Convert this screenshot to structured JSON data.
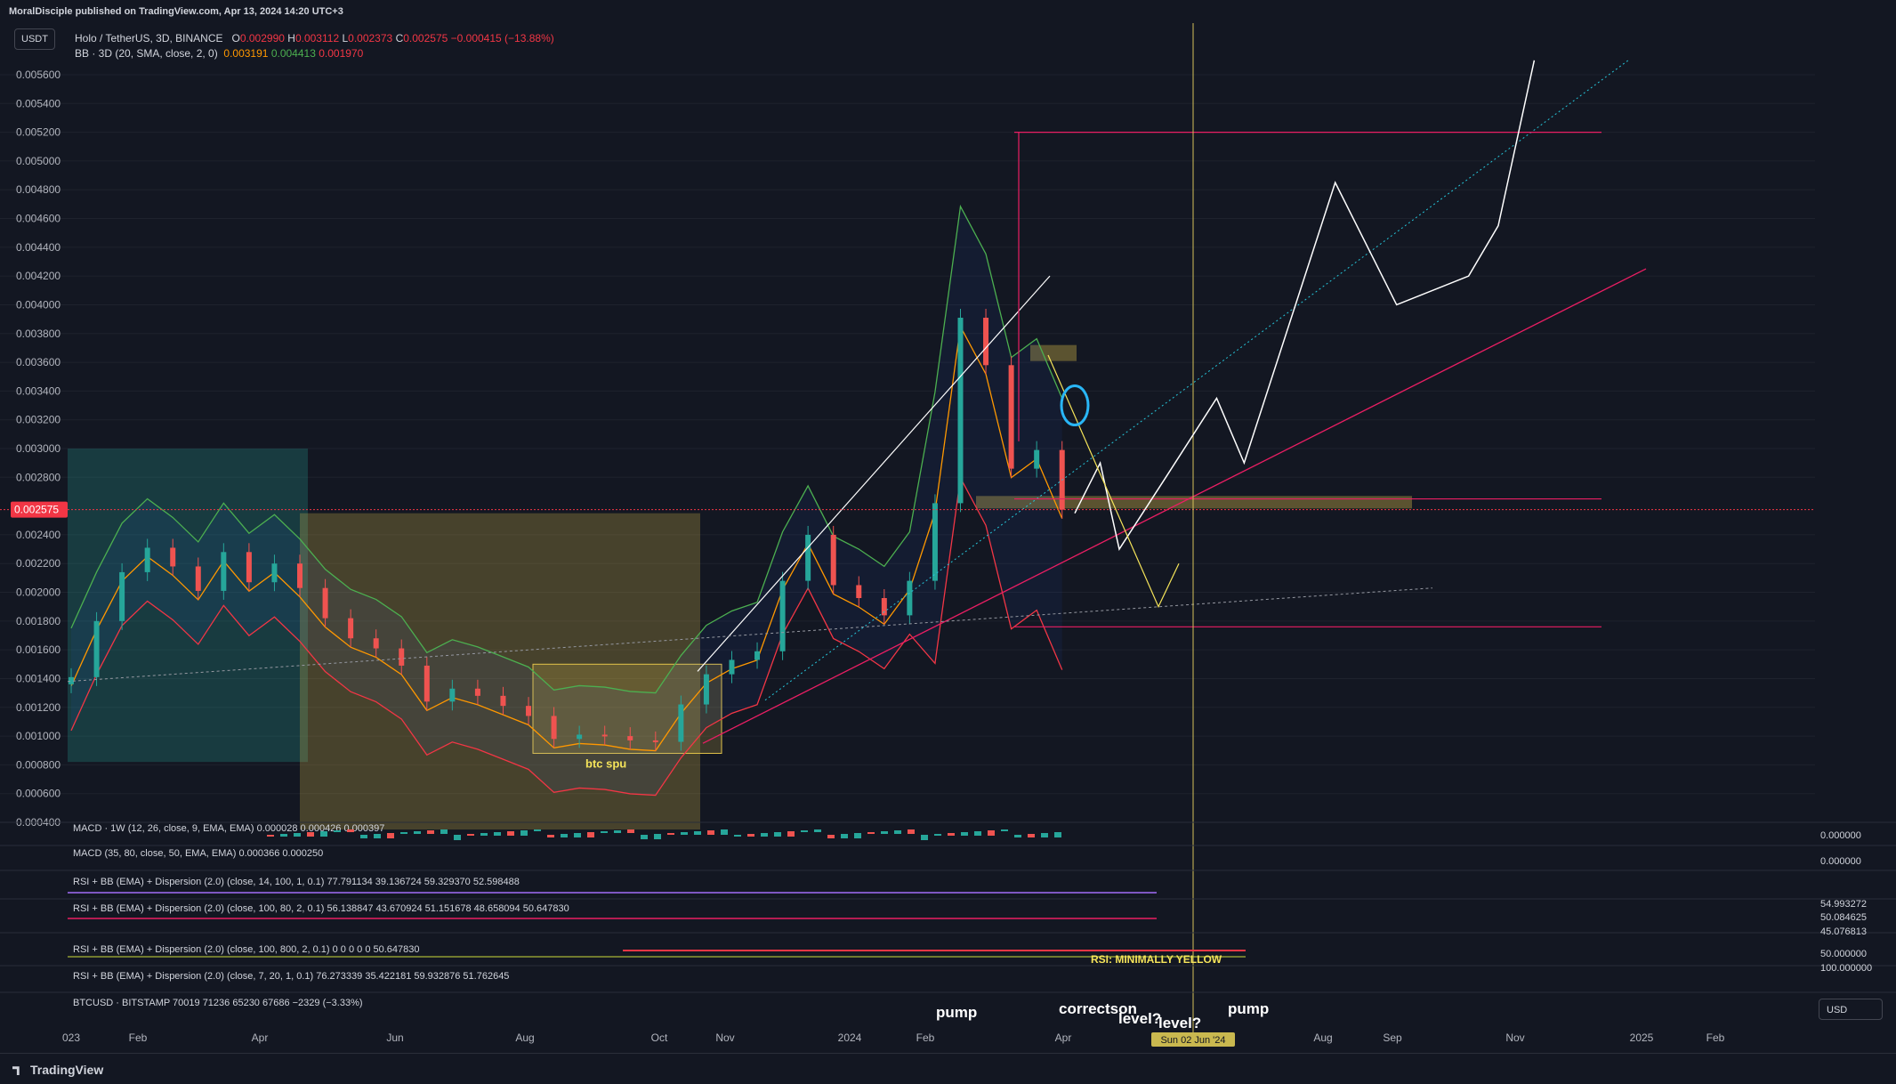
{
  "header": {
    "published": "MoralDisciple published on TradingView.com, Apr 13, 2024 14:20 UTC+3"
  },
  "symbol": {
    "name": "Holo / TetherUS, 3D, BINANCE",
    "open_label": "O",
    "open": "0.002990",
    "high_label": "H",
    "high": "0.003112",
    "low_label": "L",
    "low": "0.002373",
    "close_label": "C",
    "close": "0.002575",
    "change": "−0.000415 (−13.88%)",
    "quote_chip": "USDT"
  },
  "bb_legend": {
    "name": "BB · 3D (20, SMA, close, 2, 0)",
    "v1": "0.003191",
    "v2": "0.004413",
    "v3": "0.001970"
  },
  "colors": {
    "background": "#131722",
    "up": "#26a69a",
    "down": "#ef5350",
    "bb_upper": "#4caf50",
    "bb_lower": "#f23645",
    "bb_basis": "#ff9800",
    "price_label": "#f23645",
    "box_teal": "#26a69a",
    "box_yellow": "#e2c34a",
    "drawing_white": "#ffffff",
    "trend_pink": "#e91e63",
    "vline_yellow": "#d4c25a",
    "annotation_yellow": "#f5e45a"
  },
  "chart_data": {
    "type": "line",
    "title": "Holo / TetherUS, 3D, BINANCE",
    "xlabel": "",
    "ylabel": "",
    "x_ticks": [
      "023",
      "Feb",
      "Apr",
      "Jun",
      "Aug",
      "Oct",
      "Nov",
      "2024",
      "Feb",
      "Apr",
      "Aug",
      "Sep",
      "Nov",
      "2025",
      "Feb"
    ],
    "y_ticks": [
      "0.005600",
      "0.005400",
      "0.005200",
      "0.005000",
      "0.004800",
      "0.004600",
      "0.004400",
      "0.004200",
      "0.004000",
      "0.003800",
      "0.003600",
      "0.003400",
      "0.003200",
      "0.003000",
      "0.002800",
      "0.002400",
      "0.002200",
      "0.002000",
      "0.001800",
      "0.001600",
      "0.001400",
      "0.001200",
      "0.001000",
      "0.000800",
      "0.000600",
      "0.000400"
    ],
    "ylim": [
      0.0003,
      0.0058
    ],
    "last_price_label": "0.002575",
    "time_label": "Sun 02 Jun '24",
    "series": [
      {
        "x": [
          "2023-01-01",
          "2023-01-13",
          "2023-01-25",
          "2023-02-06",
          "2023-02-18",
          "2023-03-02",
          "2023-03-14",
          "2023-03-26",
          "2023-04-07",
          "2023-04-19",
          "2023-05-01",
          "2023-05-13",
          "2023-05-25",
          "2023-06-06",
          "2023-06-18",
          "2023-06-30",
          "2023-07-12",
          "2023-07-24",
          "2023-08-05",
          "2023-08-17",
          "2023-08-29",
          "2023-09-10",
          "2023-09-22",
          "2023-10-04",
          "2023-10-16",
          "2023-10-28",
          "2023-11-09",
          "2023-11-21",
          "2023-12-03",
          "2023-12-15",
          "2023-12-27",
          "2024-01-08",
          "2024-01-20",
          "2024-02-01",
          "2024-02-13",
          "2024-02-25",
          "2024-03-08",
          "2024-03-20",
          "2024-04-01",
          "2024-04-13"
        ],
        "y": [
          0.00141,
          0.0018,
          0.00214,
          0.00231,
          0.00218,
          0.00201,
          0.00228,
          0.00207,
          0.0022,
          0.00203,
          0.00182,
          0.00168,
          0.00161,
          0.00149,
          0.00124,
          0.00133,
          0.00128,
          0.00121,
          0.00114,
          0.00098,
          0.00101,
          0.001,
          0.00097,
          0.00096,
          0.00122,
          0.00143,
          0.00153,
          0.00159,
          0.00208,
          0.0024,
          0.00205,
          0.00196,
          0.00184,
          0.00208,
          0.00262,
          0.00391,
          0.00358,
          0.00286,
          0.00299,
          0.002575
        ]
      },
      {
        "x": [
          "2024-04-19",
          "2024-05-01",
          "2024-05-10",
          "2024-06-01",
          "2024-06-25",
          "2024-07-08",
          "2024-08-20",
          "2024-09-18",
          "2024-10-22",
          "2024-11-05",
          "2024-11-22"
        ],
        "y": [
          0.00255,
          0.0029,
          0.0023,
          0.0028,
          0.00335,
          0.0029,
          0.00485,
          0.004,
          0.0042,
          0.00455,
          0.0057
        ]
      }
    ],
    "levels": [
      0.0052,
      0.00265,
      0.00176
    ],
    "annotations": [
      "btc spu",
      "RSI: MINIMALLY YELLOW",
      "pump",
      "correctson",
      "level?",
      "level?",
      "pump"
    ]
  },
  "panes": {
    "macd1": "MACD · 1W (12, 26, close, 9, EMA, EMA)  0.000028  0.000426  0.000397",
    "macd1_scale": "0.000000",
    "macd2": "MACD (35, 80, close, 50, EMA, EMA)  0.000366  0.000250",
    "macd2_scale": "0.000000",
    "rsi1": "RSI + BB (EMA) + Dispersion (2.0) (close, 14, 100, 1, 0.1)  77.791134  39.136724  59.329370  52.598488",
    "rsi2": "RSI + BB (EMA) + Dispersion (2.0) (close, 100, 80, 2, 0.1)  56.138847  43.670924  51.151678  48.658094  50.647830",
    "rsi2_scale": [
      "54.993272",
      "50.084625",
      "45.076813"
    ],
    "rsi3": "RSI + BB (EMA) + Dispersion (2.0) (close, 100, 800, 2, 0.1)  0  0  0  0  0  50.647830",
    "rsi3_scale": "50.000000",
    "rsi4": "RSI + BB (EMA) + Dispersion (2.0) (close, 7, 20, 1, 0.1)  76.273339  35.422181  59.932876  51.762645",
    "rsi4_scale": "100.000000",
    "btc": "BTCUSD · BITSTAMP  70019  71236  65230  67686  −2329 (−3.33%)",
    "btc_chip": "USD"
  },
  "footer": {
    "brand": "TradingView"
  }
}
